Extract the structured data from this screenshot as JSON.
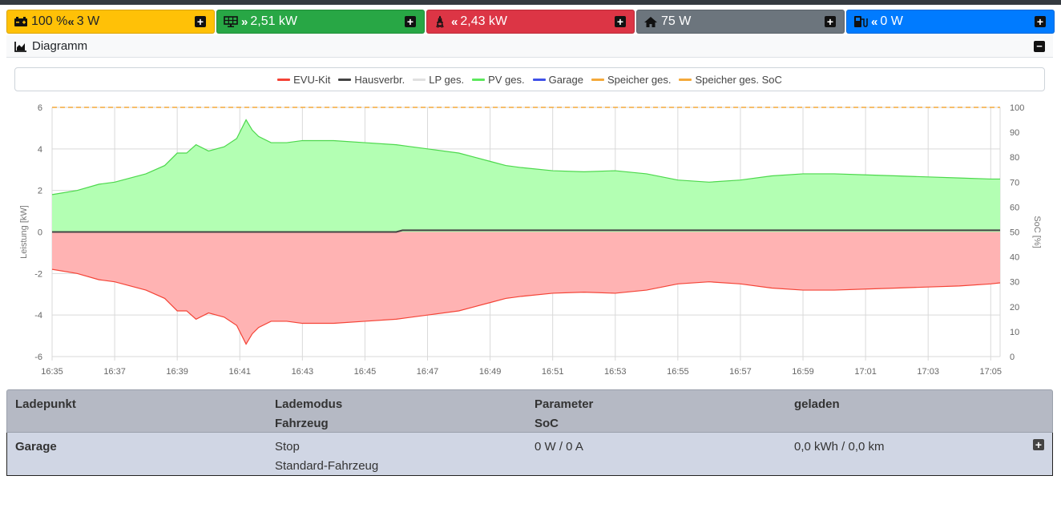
{
  "tiles": [
    {
      "value": "100 % ",
      "arrow": "«",
      "extra": "3 W",
      "icon": "battery-icon"
    },
    {
      "value": "",
      "arrow": "»",
      "extra": "2,51 kW",
      "icon": "solar-panel-icon"
    },
    {
      "value": "",
      "arrow": "«",
      "extra": "2,43 kW",
      "icon": "power-tower-icon"
    },
    {
      "value": "",
      "arrow": "",
      "extra": "75 W",
      "icon": "house-icon"
    },
    {
      "value": "",
      "arrow": "«",
      "extra": "0 W",
      "icon": "charging-station-icon"
    }
  ],
  "diagram": {
    "title": "Diagramm",
    "icon": "area-chart-icon"
  },
  "colors": {
    "evu_line": "#f44336",
    "evu_fill": "#ffb3b3",
    "pv_line": "#4cd84c",
    "pv_fill": "#b3ffb3",
    "house": "#444444",
    "lp": "#e0e0e0",
    "garage": "#3f51e8",
    "speicher": "#f4a93a"
  },
  "chart_data": {
    "type": "area",
    "legend": [
      "EVU-Kit",
      "Hausverbr.",
      "LP ges.",
      "PV ges.",
      "Garage",
      "Speicher ges.",
      "Speicher ges. SoC"
    ],
    "legend_colors": [
      "#f44336",
      "#444444",
      "#e0e0e0",
      "#5de85d",
      "#3f51e8",
      "#f4a93a",
      "#f4a93a"
    ],
    "ylabel": "Leistung [kW]",
    "y2label": "SoC [%]",
    "ylim": [
      -6,
      6
    ],
    "y2lim": [
      0,
      100
    ],
    "yticks": [
      "6",
      "4",
      "2",
      "0",
      "-2",
      "-4",
      "-6"
    ],
    "y2ticks": [
      "100",
      "90",
      "80",
      "70",
      "60",
      "50",
      "40",
      "30",
      "20",
      "10",
      "0"
    ],
    "xticks": [
      "16:35",
      "16:37",
      "16:39",
      "16:41",
      "16:43",
      "16:45",
      "16:47",
      "16:49",
      "16:51",
      "16:53",
      "16:55",
      "16:57",
      "16:59",
      "17:01",
      "17:03",
      "17:05"
    ],
    "xlim_minutes": [
      0,
      30.3
    ],
    "grid": true,
    "series": [
      {
        "name": "PV ges.",
        "x": [
          0,
          0.8,
          1.5,
          2,
          3,
          3.6,
          4,
          4.3,
          4.6,
          5,
          5.5,
          5.9,
          6.2,
          6.4,
          6.6,
          7,
          7.5,
          8,
          9,
          10,
          11,
          12,
          13,
          13.5,
          14,
          14.5,
          15,
          16,
          17,
          18,
          19,
          20,
          21,
          22,
          23,
          24,
          24.7,
          25,
          26,
          27,
          28,
          29,
          30,
          30.3
        ],
        "y": [
          1.8,
          2.0,
          2.3,
          2.4,
          2.8,
          3.2,
          3.8,
          3.8,
          4.2,
          3.9,
          4.1,
          4.5,
          5.4,
          4.9,
          4.6,
          4.3,
          4.3,
          4.4,
          4.4,
          4.3,
          4.2,
          4.0,
          3.8,
          3.6,
          3.4,
          3.2,
          3.1,
          2.95,
          2.9,
          2.95,
          2.8,
          2.5,
          2.4,
          2.5,
          2.7,
          2.8,
          2.8,
          2.8,
          2.75,
          2.7,
          2.65,
          2.6,
          2.55,
          2.55
        ]
      },
      {
        "name": "EVU-Kit",
        "x": [
          0,
          0.8,
          1.5,
          2,
          3,
          3.6,
          4,
          4.3,
          4.6,
          5,
          5.5,
          5.9,
          6.2,
          6.4,
          6.6,
          7,
          7.5,
          8,
          9,
          10,
          11,
          12,
          13,
          13.5,
          14,
          14.5,
          15,
          16,
          17,
          18,
          19,
          20,
          21,
          22,
          23,
          24,
          24.7,
          25,
          26,
          27,
          28,
          29,
          30,
          30.3
        ],
        "y": [
          -1.8,
          -2.0,
          -2.3,
          -2.4,
          -2.8,
          -3.2,
          -3.8,
          -3.8,
          -4.2,
          -3.9,
          -4.1,
          -4.5,
          -5.4,
          -4.9,
          -4.6,
          -4.3,
          -4.3,
          -4.4,
          -4.4,
          -4.3,
          -4.2,
          -4.0,
          -3.8,
          -3.6,
          -3.4,
          -3.2,
          -3.1,
          -2.95,
          -2.9,
          -2.95,
          -2.8,
          -2.5,
          -2.4,
          -2.5,
          -2.7,
          -2.8,
          -2.8,
          -2.8,
          -2.75,
          -2.7,
          -2.65,
          -2.6,
          -2.5,
          -2.45
        ]
      },
      {
        "name": "Hausverbr.",
        "x": [
          0,
          11,
          11.2,
          30.3
        ],
        "y": [
          0.0,
          0.0,
          0.08,
          0.08
        ]
      },
      {
        "name": "Speicher ges. SoC",
        "x": [
          0,
          30.3
        ],
        "y2": [
          100,
          100
        ]
      }
    ]
  },
  "table": {
    "headers": [
      {
        "line1": "Ladepunkt",
        "line2": ""
      },
      {
        "line1": "Lademodus",
        "line2": "Fahrzeug"
      },
      {
        "line1": "Parameter",
        "line2": "SoC"
      },
      {
        "line1": "geladen",
        "line2": ""
      }
    ],
    "row": {
      "name": "Garage",
      "mode": "Stop",
      "vehicle": "Standard-Fahrzeug",
      "params": "0 W / 0 A",
      "charged": "0,0 kWh / 0,0 km"
    }
  }
}
